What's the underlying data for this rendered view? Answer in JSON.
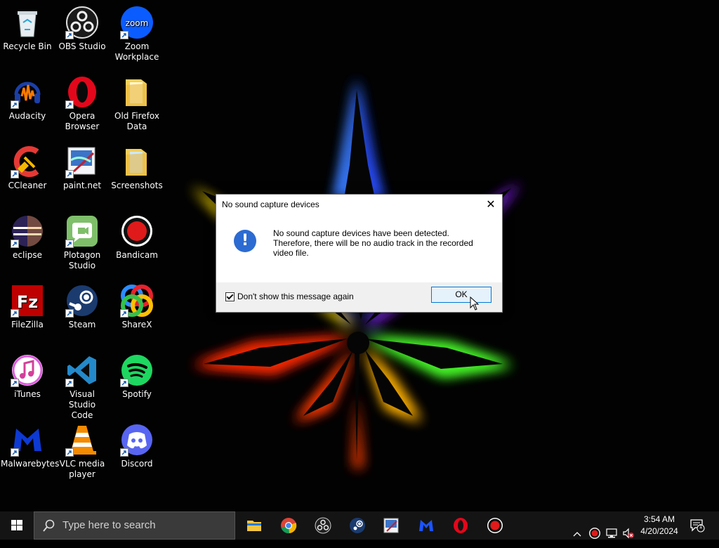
{
  "desktop_icons": [
    {
      "label": "Recycle Bin",
      "icon": "recycle-bin-icon"
    },
    {
      "label": "OBS Studio",
      "icon": "obs-studio-icon"
    },
    {
      "label": "Zoom\nWorkplace",
      "icon": "zoom-icon"
    },
    {
      "label": "Audacity",
      "icon": "audacity-icon"
    },
    {
      "label": "Opera\nBrowser",
      "icon": "opera-icon"
    },
    {
      "label": "Old Firefox\nData",
      "icon": "folder-icon"
    },
    {
      "label": "CCleaner",
      "icon": "ccleaner-icon"
    },
    {
      "label": "paint.net",
      "icon": "paint-net-icon"
    },
    {
      "label": "Screenshots",
      "icon": "folder-icon"
    },
    {
      "label": "eclipse",
      "icon": "eclipse-icon"
    },
    {
      "label": "Plotagon\nStudio",
      "icon": "plotagon-icon"
    },
    {
      "label": "Bandicam",
      "icon": "bandicam-icon"
    },
    {
      "label": "FileZilla",
      "icon": "filezilla-icon"
    },
    {
      "label": "Steam",
      "icon": "steam-icon"
    },
    {
      "label": "ShareX",
      "icon": "sharex-icon"
    },
    {
      "label": "iTunes",
      "icon": "itunes-icon"
    },
    {
      "label": "Visual Studio\nCode",
      "icon": "vscode-icon"
    },
    {
      "label": "Spotify",
      "icon": "spotify-icon"
    },
    {
      "label": "Malwarebytes",
      "icon": "malwarebytes-icon"
    },
    {
      "label": "VLC media\nplayer",
      "icon": "vlc-icon"
    },
    {
      "label": "Discord",
      "icon": "discord-icon"
    }
  ],
  "dialog": {
    "title": "No sound capture devices",
    "close_glyph": "✕",
    "info_glyph": "!",
    "message": "No sound capture devices have been detected.\nTherefore, there will be no audio track in the recorded\nvideo file.",
    "checkbox_label": "Don't show this message again",
    "checkbox_checked": true,
    "ok_label": "OK"
  },
  "taskbar": {
    "search_placeholder": "Type here to search",
    "pinned": [
      "file-explorer-icon",
      "chrome-icon",
      "obs-studio-icon",
      "steam-icon",
      "paint-net-icon",
      "malwarebytes-icon",
      "opera-icon",
      "bandicam-icon"
    ],
    "clock_time": "3:54 AM",
    "clock_date": "4/20/2024",
    "notification_count": "1"
  },
  "colors": {
    "accent": "#0078d7",
    "info_blue": "#2c6bd1",
    "taskbar_bg": "#141414"
  }
}
